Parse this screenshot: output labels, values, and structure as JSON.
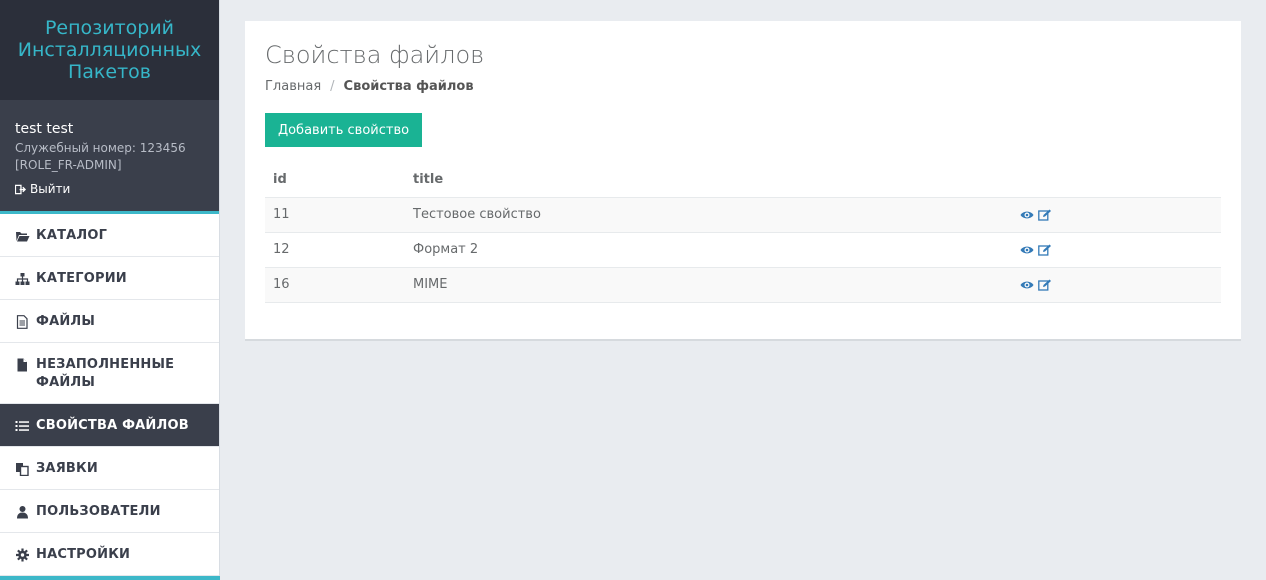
{
  "app": {
    "title": "Репозиторий Инсталляционных Пакетов",
    "accent_color": "#36b6c8",
    "primary_button_color": "#1ab394"
  },
  "user": {
    "name": "test test",
    "service_number": "Служебный номер: 123456",
    "role": "[ROLE_FR-ADMIN]",
    "logout_label": "Выйти",
    "logout_icon": "sign-out-icon"
  },
  "sidebar": {
    "items": [
      {
        "label": "КАТАЛОГ",
        "icon": "folder-open-icon",
        "active": false
      },
      {
        "label": "КАТЕГОРИИ",
        "icon": "sitemap-icon",
        "active": false
      },
      {
        "label": "ФАЙЛЫ",
        "icon": "file-text-icon",
        "active": false
      },
      {
        "label": "НЕЗАПОЛНЕННЫЕ ФАЙЛЫ",
        "icon": "file-icon",
        "active": false
      },
      {
        "label": "СВОЙСТВА ФАЙЛОВ",
        "icon": "list-icon",
        "active": true
      },
      {
        "label": "ЗАЯВКИ",
        "icon": "copy-icon",
        "active": false
      },
      {
        "label": "ПОЛЬЗОВАТЕЛИ",
        "icon": "user-icon",
        "active": false
      },
      {
        "label": "НАСТРОЙКИ",
        "icon": "gear-icon",
        "active": false
      }
    ]
  },
  "main": {
    "page_title": "Свойства файлов",
    "breadcrumb": {
      "home": "Главная",
      "separator": "/",
      "current": "Свойства файлов"
    },
    "add_button_label": "Добавить свойство",
    "table": {
      "columns": [
        "id",
        "title",
        ""
      ],
      "rows": [
        {
          "id": "11",
          "title": "Тестовое свойство",
          "actions": [
            "eye-icon",
            "edit-icon"
          ]
        },
        {
          "id": "12",
          "title": "Формат 2",
          "actions": [
            "eye-icon",
            "edit-icon"
          ]
        },
        {
          "id": "16",
          "title": "MIME",
          "actions": [
            "eye-icon",
            "edit-icon"
          ]
        }
      ]
    }
  }
}
